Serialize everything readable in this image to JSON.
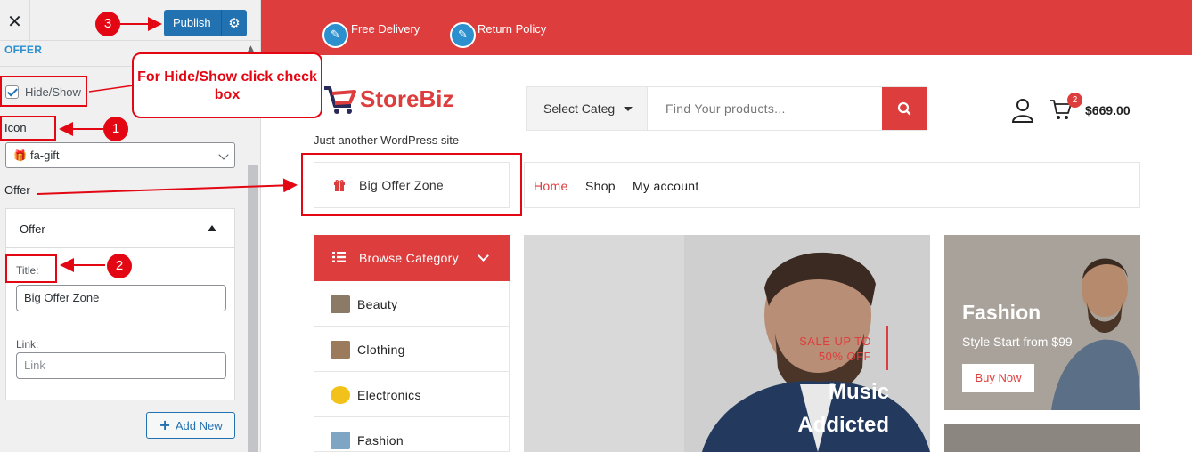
{
  "panel": {
    "close_glyph": "✕",
    "publish_label": "Publish",
    "section_title": "OFFER",
    "hide_show_label": "Hide/Show",
    "hide_show_checked": true,
    "icon_label": "Icon",
    "icon_select_value": "fa-gift",
    "offer_label": "Offer",
    "repeater": {
      "header": "Offer",
      "title_label": "Title:",
      "title_value": "Big Offer Zone",
      "link_label": "Link:",
      "link_placeholder": "Link"
    },
    "add_new_label": "Add New"
  },
  "store": {
    "topbar": {
      "items": [
        "Free Delivery",
        "Return Policy"
      ]
    },
    "logo_text": "StoreBiz",
    "tagline": "Just another WordPress site",
    "search": {
      "category": "Select Categ",
      "placeholder": "Find Your products..."
    },
    "cart": {
      "count": "2",
      "total": "$669.00"
    },
    "offer_zone": "Big Offer Zone",
    "nav": [
      "Home",
      "Shop",
      "My account"
    ],
    "browse_label": "Browse Category",
    "categories": [
      "Beauty",
      "Clothing",
      "Electronics",
      "Fashion"
    ],
    "hero": {
      "sale_line1": "SALE UP TO",
      "sale_line2": "50% OFF",
      "title_line1": "Music",
      "title_line2": "Addicted"
    },
    "side_banner": {
      "title": "Fashion",
      "subtitle": "Style Start from $99",
      "button": "Buy Now"
    }
  },
  "annotations": {
    "callout": "For Hide/Show click check box",
    "markers": [
      "1",
      "2",
      "3"
    ]
  },
  "colors": {
    "brand_red": "#de3d3d",
    "publish_blue": "#2271b1",
    "annotation_red": "#e30613",
    "edit_bubble": "#2c8fce"
  }
}
